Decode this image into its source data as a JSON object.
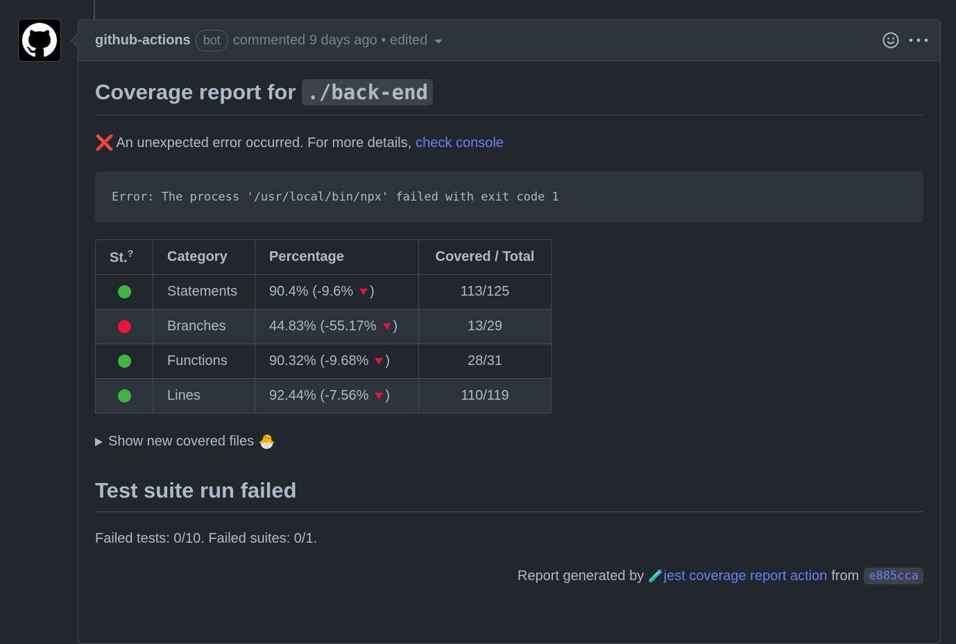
{
  "comment": {
    "author": "github-actions",
    "badge": "bot",
    "meta": "commented 9 days ago • edited"
  },
  "report": {
    "title_prefix": "Coverage report for",
    "path": "./back-end",
    "error_text": "An unexpected error occurred. For more details,",
    "error_link": "check console",
    "error_code_block": "Error: The process '/usr/local/bin/npx' failed with exit code 1"
  },
  "table": {
    "headers": {
      "status": "St.",
      "status_sup": "?",
      "category": "Category",
      "percentage": "Percentage",
      "total": "Covered / Total"
    },
    "rows": [
      {
        "status_color": "#3fb541",
        "category": "Statements",
        "pct": "90.4% (-9.6%",
        "pct_close": ")",
        "total": "113/125"
      },
      {
        "status_color": "#e5183c",
        "category": "Branches",
        "pct": "44.83% (-55.17%",
        "pct_close": ")",
        "total": "13/29"
      },
      {
        "status_color": "#3fb541",
        "category": "Functions",
        "pct": "90.32% (-9.68%",
        "pct_close": ")",
        "total": "28/31"
      },
      {
        "status_color": "#3fb541",
        "category": "Lines",
        "pct": "92.44% (-7.56%",
        "pct_close": ")",
        "total": "110/119"
      }
    ]
  },
  "details": {
    "summary": "Show new covered files",
    "emoji": "🐣"
  },
  "suite": {
    "title": "Test suite run failed",
    "failed": "Failed tests: 0/10. Failed suites: 0/1."
  },
  "footer": {
    "prefix": "Report generated by",
    "emoji": "🧪",
    "link": "jest coverage report action",
    "from": "from",
    "sha": "e885cca"
  },
  "colors": {
    "link": "#6a7ef5",
    "error": "#e5534b",
    "down_arrow": "#e5183c"
  }
}
